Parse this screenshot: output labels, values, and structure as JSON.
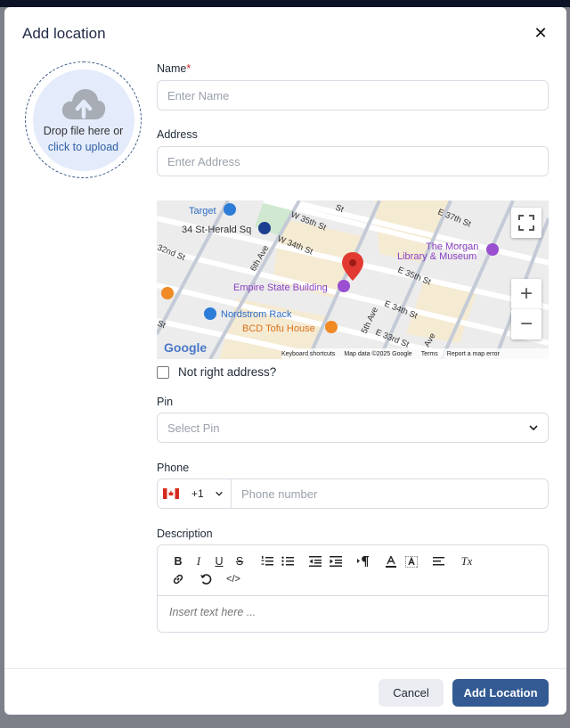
{
  "modal": {
    "title": "Add location",
    "close_glyph": "✕"
  },
  "upload": {
    "icon": "cloud-upload-icon",
    "text": "Drop file here or",
    "link": "click to upload"
  },
  "name_field": {
    "label": "Name",
    "required_mark": "*",
    "placeholder": "Enter Name"
  },
  "address_field": {
    "label": "Address",
    "placeholder": "Enter Address"
  },
  "map": {
    "streets": [
      "W 35th St",
      "W 34th St",
      "E 37th St",
      "E 35th St",
      "E 34th St",
      "E 33rd St",
      "6th Ave",
      "5th Ave",
      "32nd St",
      "St",
      "Ave",
      "St"
    ],
    "places": [
      "Target",
      "34 St-Herald Sq",
      "The Morgan",
      "Library & Museum",
      "Empire State Building",
      "Nordstrom Rack",
      "BCD Tofu House"
    ],
    "logo": "Google",
    "footer": [
      "Keyboard shortcuts",
      "Map data ©2025 Google",
      "Terms",
      "Report a map error"
    ],
    "zoom_in": "+",
    "zoom_out": "−",
    "colors": {
      "road": "#ffffff",
      "land": "#ececec",
      "park": "#f5ead2",
      "pin": "#e23a32"
    }
  },
  "checkbox": {
    "label": "Not right address?"
  },
  "pin_field": {
    "label": "Pin",
    "placeholder": "Select Pin"
  },
  "phone_field": {
    "label": "Phone",
    "country_code": "+1",
    "placeholder": "Phone number"
  },
  "description_field": {
    "label": "Description",
    "toolbar": {
      "bold": "B",
      "italic": "I",
      "underline": "U",
      "strike": "S",
      "clear_format": "Tx",
      "code": "</>"
    },
    "placeholder": "Insert text here ..."
  },
  "footer": {
    "cancel": "Cancel",
    "submit": "Add Location"
  }
}
